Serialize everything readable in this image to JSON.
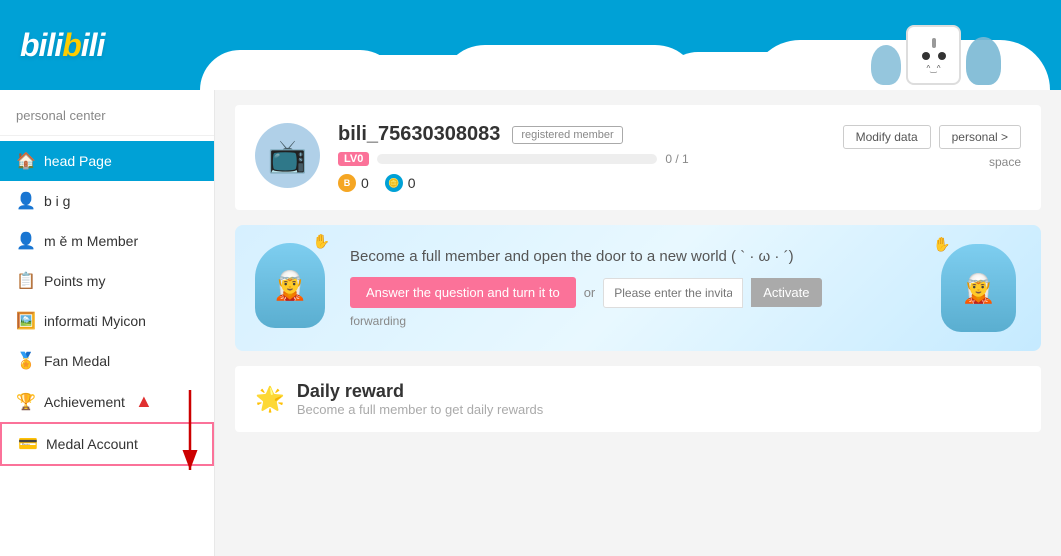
{
  "header": {
    "logo_text": "bilibili",
    "site_name": "bilibili"
  },
  "sidebar": {
    "title": "personal center",
    "items": [
      {
        "id": "head-page",
        "label": "head  Page",
        "icon": "🏠",
        "active": true
      },
      {
        "id": "big",
        "label": "b i g",
        "icon": "👤",
        "active": false
      },
      {
        "id": "member",
        "label": "m ě m Member",
        "icon": "👤",
        "active": false
      },
      {
        "id": "my-points",
        "label": "Points  my",
        "icon": "📋",
        "active": false
      },
      {
        "id": "my-icon",
        "label": "informati Myicon",
        "icon": "🖼️",
        "active": false
      },
      {
        "id": "fan-medal",
        "label": "Fan Medal",
        "icon": "🏅",
        "active": false
      },
      {
        "id": "achievement",
        "label": "Achievement",
        "icon": "🏆",
        "active": false,
        "has_arrow": true
      },
      {
        "id": "account",
        "label": "Medal  Account",
        "icon": "💳",
        "active": false,
        "highlighted": true
      }
    ]
  },
  "profile": {
    "username": "bili_75630308083",
    "member_status": "registered member",
    "level": "LV0",
    "exp_current": 0,
    "exp_max": 1,
    "exp_display": "0 / 1",
    "b_coins": 0,
    "bili_coins": 0,
    "modify_btn": "Modify data",
    "personal_btn": "personal >",
    "space_label": "space"
  },
  "member_banner": {
    "title": "Become a full member and open the door to a new world ( ` · ω · ´)",
    "answer_btn": "Answer the question and turn it to",
    "or_text": "or",
    "invite_placeholder": "Please enter the invita",
    "activate_btn": "Activate",
    "forwarding_text": "forwarding"
  },
  "daily_reward": {
    "title": "Daily reward",
    "subtitle": "Become a full member to get daily rewards",
    "icon": "🌟"
  }
}
